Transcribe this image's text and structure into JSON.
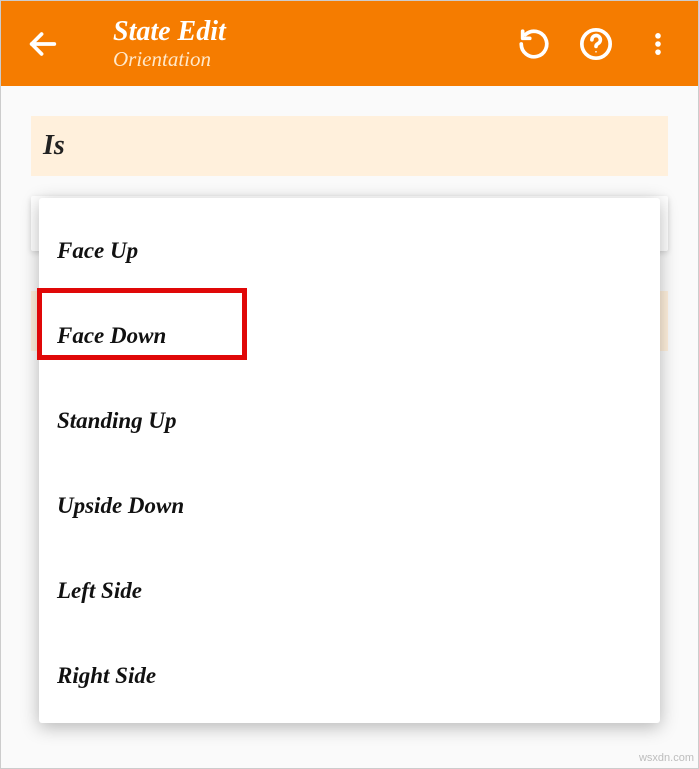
{
  "appbar": {
    "title": "State Edit",
    "subtitle": "Orientation"
  },
  "section": {
    "label": "Is"
  },
  "dropdown": {
    "items": [
      {
        "label": "Face Up"
      },
      {
        "label": "Face Down"
      },
      {
        "label": "Standing Up"
      },
      {
        "label": "Upside Down"
      },
      {
        "label": "Left Side"
      },
      {
        "label": "Right Side"
      }
    ]
  },
  "highlighted_index": 1,
  "watermark": "wsxdn.com",
  "colors": {
    "accent": "#f57c00",
    "highlight": "#e00808",
    "section_bg": "#fff0dc"
  }
}
